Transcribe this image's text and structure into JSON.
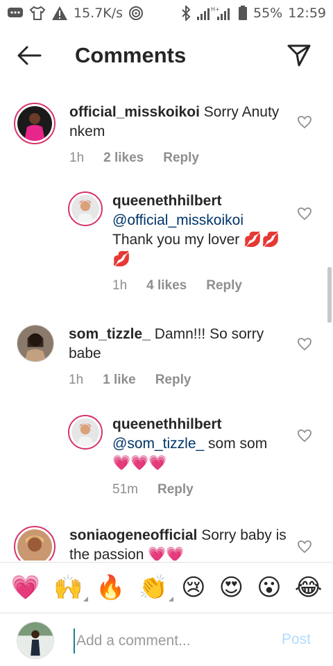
{
  "status_bar": {
    "speed": "15.7K/s",
    "battery_percent": "55%",
    "time": "12:59"
  },
  "header": {
    "title": "Comments"
  },
  "comments": [
    {
      "username": "official_misskoikoi",
      "text": " Sorry Anuty nkem",
      "time": "1h",
      "likes": "2 likes",
      "reply": "Reply"
    },
    {
      "username": "queenethhilbert",
      "mention": "@official_misskoikoi",
      "text": "Thank you my lover 💋💋💋",
      "time": "1h",
      "likes": "4 likes",
      "reply": "Reply"
    },
    {
      "username": "som_tizzle_",
      "text": " Damn!!! So sorry babe",
      "time": "1h",
      "likes": "1 like",
      "reply": "Reply"
    },
    {
      "username": "queenethhilbert",
      "mention": "@som_tizzle_",
      "text": " som som 💗💗💗",
      "time": "51m",
      "reply": "Reply"
    },
    {
      "username": "soniaogeneofficial",
      "text": " Sorry baby is the passion 💗💗"
    }
  ],
  "emoji_bar": [
    "💗",
    "🙌",
    "🔥",
    "👏",
    "😢",
    "😍",
    "😮",
    "😂"
  ],
  "input": {
    "placeholder": "Add a comment...",
    "post_label": "Post"
  },
  "colors": {
    "text": "#262626",
    "meta": "#8e8e8e",
    "mention": "#003569",
    "post_disabled": "#b3dbff",
    "story_ring": "#d6336c"
  }
}
